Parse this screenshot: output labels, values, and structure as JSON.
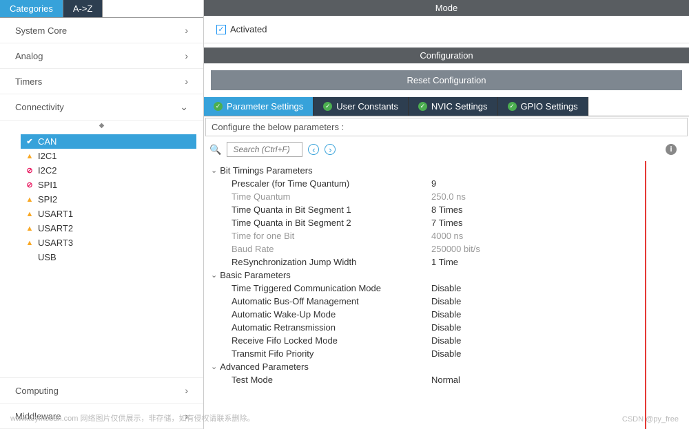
{
  "sidebar": {
    "tabs": {
      "categories": "Categories",
      "az": "A->Z"
    },
    "sections": [
      {
        "label": "System Core",
        "expanded": false
      },
      {
        "label": "Analog",
        "expanded": false
      },
      {
        "label": "Timers",
        "expanded": false
      },
      {
        "label": "Connectivity",
        "expanded": true
      },
      {
        "label": "Computing",
        "expanded": false
      },
      {
        "label": "Middleware",
        "expanded": false
      }
    ],
    "connectivity_items": [
      {
        "label": "CAN",
        "status": "check",
        "selected": true
      },
      {
        "label": "I2C1",
        "status": "warn",
        "selected": false
      },
      {
        "label": "I2C2",
        "status": "block",
        "selected": false
      },
      {
        "label": "SPI1",
        "status": "block",
        "selected": false
      },
      {
        "label": "SPI2",
        "status": "warn",
        "selected": false
      },
      {
        "label": "USART1",
        "status": "warn",
        "selected": false
      },
      {
        "label": "USART2",
        "status": "warn",
        "selected": false
      },
      {
        "label": "USART3",
        "status": "warn",
        "selected": false
      },
      {
        "label": "USB",
        "status": "none",
        "selected": false
      }
    ]
  },
  "mode": {
    "header": "Mode",
    "activated_label": "Activated",
    "activated_checked": true
  },
  "configuration": {
    "header": "Configuration",
    "reset_label": "Reset Configuration",
    "tabs": [
      {
        "label": "Parameter Settings",
        "active": true
      },
      {
        "label": "User Constants",
        "active": false
      },
      {
        "label": "NVIC Settings",
        "active": false
      },
      {
        "label": "GPIO Settings",
        "active": false
      }
    ],
    "description": "Configure the below parameters :",
    "search_placeholder": "Search (Ctrl+F)",
    "groups": [
      {
        "name": "Bit Timings Parameters",
        "rows": [
          {
            "label": "Prescaler (for Time Quantum)",
            "value": "9",
            "readonly": false
          },
          {
            "label": "Time Quantum",
            "value": "250.0 ns",
            "readonly": true
          },
          {
            "label": "Time Quanta in Bit Segment 1",
            "value": "8 Times",
            "readonly": false
          },
          {
            "label": "Time Quanta in Bit Segment 2",
            "value": "7 Times",
            "readonly": false
          },
          {
            "label": "Time for one Bit",
            "value": "4000 ns",
            "readonly": true
          },
          {
            "label": "Baud Rate",
            "value": "250000 bit/s",
            "readonly": true
          },
          {
            "label": "ReSynchronization Jump Width",
            "value": "1 Time",
            "readonly": false
          }
        ]
      },
      {
        "name": "Basic Parameters",
        "rows": [
          {
            "label": "Time Triggered Communication Mode",
            "value": "Disable",
            "readonly": false
          },
          {
            "label": "Automatic Bus-Off Management",
            "value": "Disable",
            "readonly": false
          },
          {
            "label": "Automatic Wake-Up Mode",
            "value": "Disable",
            "readonly": false
          },
          {
            "label": "Automatic Retransmission",
            "value": "Disable",
            "readonly": false
          },
          {
            "label": "Receive Fifo Locked Mode",
            "value": "Disable",
            "readonly": false
          },
          {
            "label": "Transmit Fifo Priority",
            "value": "Disable",
            "readonly": false
          }
        ]
      },
      {
        "name": "Advanced Parameters",
        "rows": [
          {
            "label": "Test Mode",
            "value": "Normal",
            "readonly": false
          }
        ]
      }
    ]
  },
  "watermark": {
    "left": "www.toymoban.com 网络图片仅供展示，非存储，如有侵权请联系删除。",
    "right": "CSDN @py_free"
  }
}
